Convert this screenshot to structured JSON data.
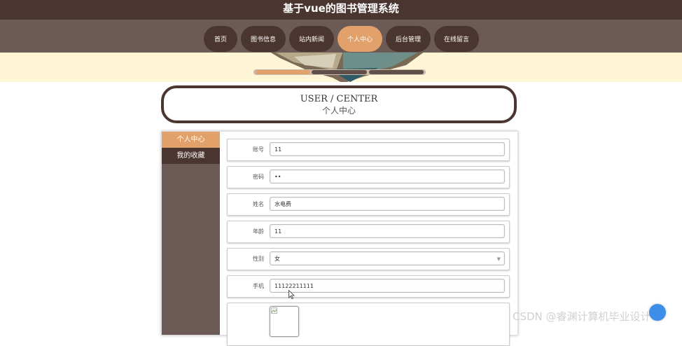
{
  "app": {
    "title": "基于vue的图书管理系统"
  },
  "nav": {
    "items": [
      {
        "label": "首页",
        "w": 48
      },
      {
        "label": "图书信息",
        "w": 64
      },
      {
        "label": "站内新闻",
        "w": 64
      },
      {
        "label": "个人中心",
        "w": 64,
        "active": true
      },
      {
        "label": "后台管理",
        "w": 64
      },
      {
        "label": "在线留言",
        "w": 64
      }
    ]
  },
  "page": {
    "title_en": "USER / CENTER",
    "title_cn": "个人中心"
  },
  "sidebar": {
    "items": [
      {
        "label": "个人中心",
        "active": true
      },
      {
        "label": "我的收藏"
      }
    ]
  },
  "form": {
    "fields": [
      {
        "label": "账号",
        "value": "11"
      },
      {
        "label": "密码",
        "value": "••"
      },
      {
        "label": "姓名",
        "value": "水电费"
      },
      {
        "label": "年龄",
        "value": "11"
      },
      {
        "label": "性别",
        "value": "女"
      },
      {
        "label": "手机",
        "value": "11122211111"
      }
    ]
  },
  "watermark": {
    "text": "CSDN @睿渊计算机毕业设计"
  },
  "colors": {
    "primary_dark": "#4a3530",
    "accent": "#e2a06b",
    "nav_bg": "#6b5a55",
    "banner_bg": "#fdf5d6"
  },
  "icons": {
    "select_caret": "chevron-down-icon",
    "broken_image": "broken-image-icon",
    "pointer": "mouse-cursor-icon",
    "float": "scroll-top-icon"
  }
}
